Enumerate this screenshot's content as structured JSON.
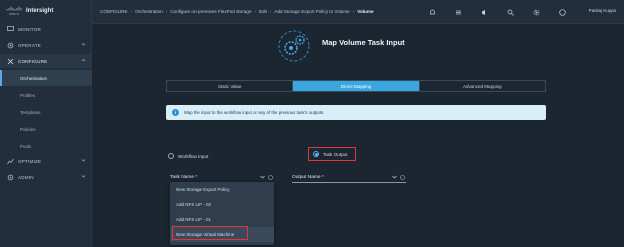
{
  "app": {
    "logo_mark": "cisco",
    "logo_text": "Intersight"
  },
  "sidebar": {
    "items": [
      {
        "label": "MONITOR",
        "icon": "monitor-icon"
      },
      {
        "label": "OPERATE",
        "icon": "operate-icon"
      },
      {
        "label": "CONFIGURE",
        "icon": "configure-icon"
      }
    ],
    "sub_items": [
      {
        "label": "Orchestration",
        "active": true
      },
      {
        "label": "Profiles"
      },
      {
        "label": "Templates"
      },
      {
        "label": "Policies"
      },
      {
        "label": "Pools"
      }
    ],
    "bottom_items": [
      {
        "label": "OPTIMIZE",
        "icon": "optimize-icon"
      },
      {
        "label": "ADMIN",
        "icon": "admin-icon"
      }
    ]
  },
  "breadcrumb": {
    "items": [
      "CONFIGURE",
      "Orchestration",
      "Configure on-premises FlexPod storage",
      "Edit",
      "Add Storage Export Policy to Volume"
    ],
    "current": "Volume"
  },
  "topbar": {
    "user": "Pankaj Kuppa",
    "icons": [
      "bell-icon",
      "list-icon",
      "announce-icon",
      "search-icon",
      "settings-icon",
      "help-icon"
    ]
  },
  "main": {
    "title": "Map Volume Task Input",
    "tabs": [
      "Static Value",
      "Direct Mapping",
      "Advanced Mapping"
    ],
    "active_tab": "Direct Mapping",
    "info_text": "Map the input to the workflow input or any of the previous task's outputs.",
    "radio_options": [
      {
        "label": "Workflow Input",
        "selected": false
      },
      {
        "label": "Task Output",
        "selected": true
      }
    ],
    "task_name_label": "Task Name *",
    "output_name_label": "Output Name *",
    "menu_items": [
      "New Storage Export Policy",
      "Add NFS LIF - 02",
      "Add NFS LIF - 01",
      "New Storage Virtual Machine"
    ]
  }
}
